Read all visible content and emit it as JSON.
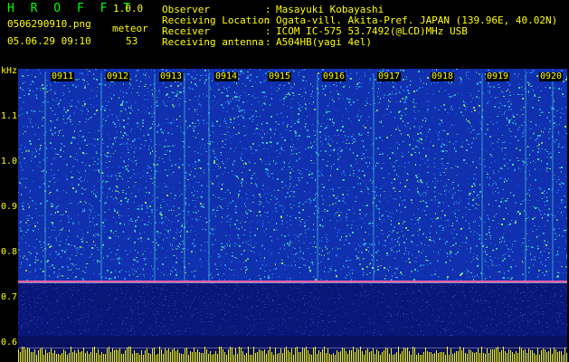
{
  "header": {
    "app_title": "H R O F F T",
    "app_version": "1.0.0",
    "filename": "0506290910.png",
    "meteor_label": "meteor",
    "datetime": "05.06.29 09:10",
    "meteor_count": "53",
    "info": [
      {
        "label": "Observer",
        "value": "Masayuki Kobayashi"
      },
      {
        "label": "Receiving Location",
        "value": "Ogata-vill. Akita-Pref. JAPAN (139.96E, 40.02N)"
      },
      {
        "label": "Receiver",
        "value": "ICOM IC-575 53.7492(@LCD)MHz USB"
      },
      {
        "label": "Receiving antenna",
        "value": "A504HB(yagi 4el)"
      }
    ],
    "separator": ":"
  },
  "axis": {
    "unit": "kHz",
    "ticks": [
      "1.1",
      "1.0",
      "0.9",
      "0.8",
      "0.7",
      "0.6"
    ]
  },
  "time_labels": [
    "0911",
    "0912",
    "0913",
    "0914",
    "0915",
    "0916",
    "0917",
    "0918",
    "0919",
    "0920"
  ],
  "colors": {
    "header_text": "#ffff00",
    "title_text": "#00ff00",
    "spectrogram_base": "#0b1a8a",
    "signal_line": "#ff66aa",
    "baseline_bars": "#ffff00"
  }
}
